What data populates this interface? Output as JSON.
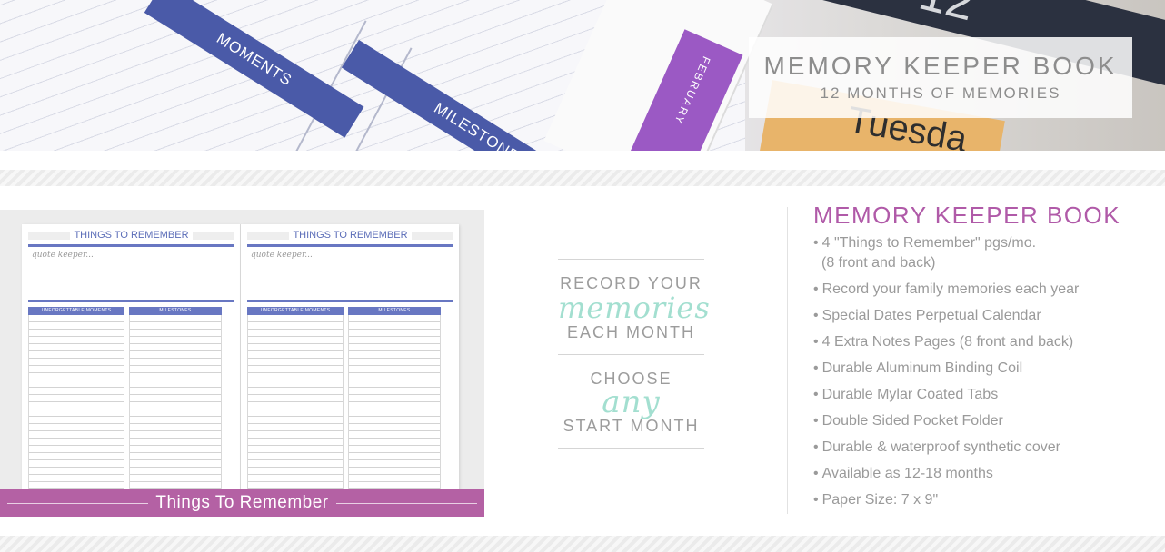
{
  "hero": {
    "band_one_label": "MOMENTS",
    "band_two_label": "MILESTONES",
    "tab_label": "FEBRUARY",
    "ruler_text": "12",
    "block_text": "Tuesda",
    "title": "MEMORY KEEPER BOOK",
    "subtitle": "12 MONTHS OF MEMORIES"
  },
  "preview": {
    "sheets": [
      {
        "header": "THINGS TO REMEMBER",
        "quote_label": "quote keeper...",
        "left_column": "UNFORGETTABLE MOMENTS",
        "right_column": "MILESTONES"
      },
      {
        "header": "THINGS TO REMEMBER",
        "quote_label": "quote keeper...",
        "left_column": "UNFORGETTABLE MOMENTS",
        "right_column": "MILESTONES"
      }
    ],
    "caption": "Things To Remember"
  },
  "promo": {
    "record_line1": "RECORD YOUR",
    "record_script": "memories",
    "record_line2": "EACH MONTH",
    "choose_line1": "CHOOSE",
    "choose_script": "any",
    "choose_line2": "START MONTH"
  },
  "features": {
    "title": "MEMORY KEEPER BOOK",
    "items": [
      "4 \"Things to Remember\" pgs/mo.",
      "(8 front and back)",
      "Record your family memories each year",
      "Special Dates Perpetual Calendar",
      "4 Extra Notes Pages (8 front and back)",
      "Durable Aluminum Binding Coil",
      "Durable Mylar Coated Tabs",
      "Double Sided Pocket Folder",
      "Durable & waterproof synthetic cover",
      "Available as 12-18 months",
      "Paper Size: 7 x 9\""
    ]
  },
  "colors": {
    "band_blue": "#4a5aa8",
    "tab_purple": "#9b59c4",
    "caption_magenta": "#b461a4",
    "features_title": "#b05aa8",
    "script_mint": "#a3dfd0"
  }
}
